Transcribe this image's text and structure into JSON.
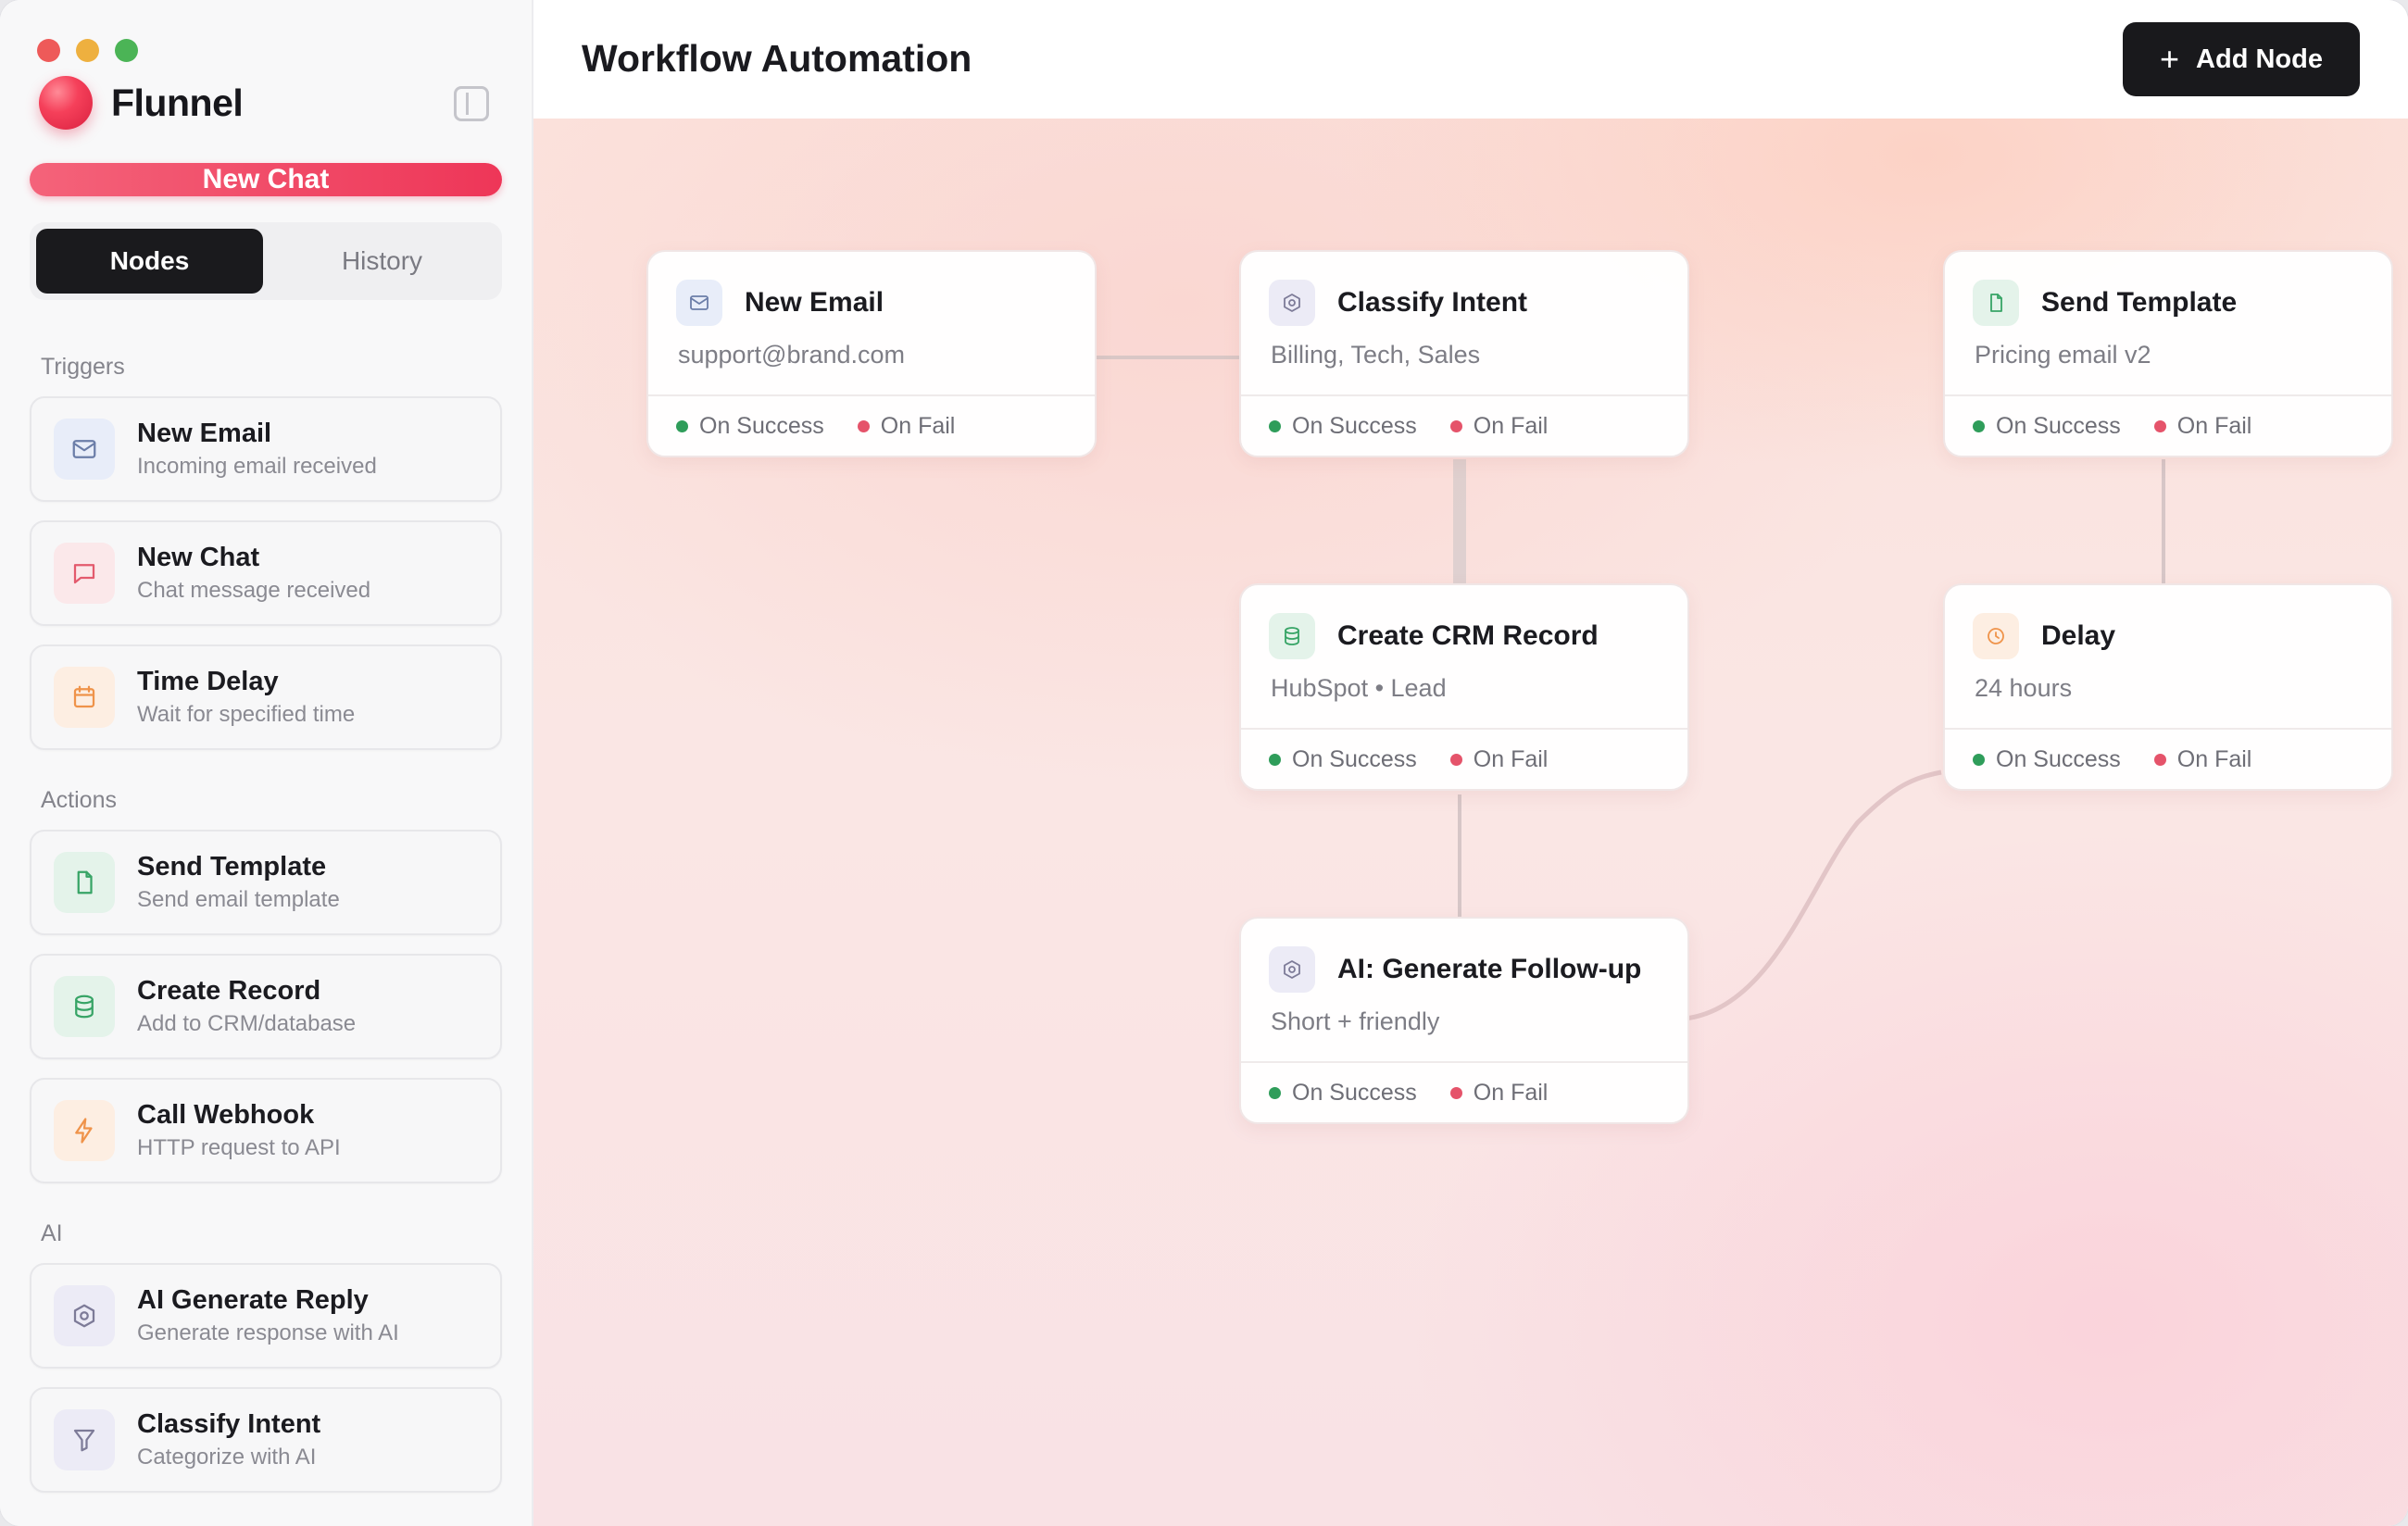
{
  "window": {
    "traffic_lights": [
      "close",
      "minimize",
      "maximize"
    ]
  },
  "app": {
    "name": "Flunnel"
  },
  "sidebar": {
    "new_chat_label": "New Chat",
    "tabs": [
      {
        "label": "Nodes",
        "active": true
      },
      {
        "label": "History",
        "active": false
      }
    ],
    "sections": {
      "triggers": {
        "label": "Triggers",
        "items": [
          {
            "title": "New Email",
            "subtitle": "Incoming email received",
            "icon": "mail-icon"
          },
          {
            "title": "New Chat",
            "subtitle": "Chat message received",
            "icon": "chat-icon"
          },
          {
            "title": "Time Delay",
            "subtitle": "Wait for specified time",
            "icon": "calendar-icon"
          }
        ]
      },
      "actions": {
        "label": "Actions",
        "items": [
          {
            "title": "Send Template",
            "subtitle": "Send email template",
            "icon": "file-icon"
          },
          {
            "title": "Create Record",
            "subtitle": "Add to CRM/database",
            "icon": "database-icon"
          },
          {
            "title": "Call Webhook",
            "subtitle": "HTTP request to API",
            "icon": "bolt-icon"
          }
        ]
      },
      "ai": {
        "label": "AI",
        "items": [
          {
            "title": "AI Generate Reply",
            "subtitle": "Generate response with AI",
            "icon": "ai-hexagon-icon"
          },
          {
            "title": "Classify Intent",
            "subtitle": "Categorize with AI",
            "icon": "filter-icon"
          }
        ]
      }
    }
  },
  "header": {
    "title": "Workflow Automation",
    "add_node_label": "Add Node"
  },
  "ports": {
    "success": "On Success",
    "fail": "On Fail"
  },
  "workflow": {
    "nodes": [
      {
        "id": "n1",
        "title": "New Email",
        "subtitle": "support@brand.com",
        "icon": "mail-icon"
      },
      {
        "id": "n2",
        "title": "Classify Intent",
        "subtitle": "Billing, Tech, Sales",
        "icon": "ai-hexagon-icon"
      },
      {
        "id": "n3",
        "title": "Send Template",
        "subtitle": "Pricing email v2",
        "icon": "file-icon"
      },
      {
        "id": "n4",
        "title": "Create CRM Record",
        "subtitle": "HubSpot • Lead",
        "icon": "database-icon"
      },
      {
        "id": "n5",
        "title": "Delay",
        "subtitle": "24 hours",
        "icon": "clock-icon"
      },
      {
        "id": "n6",
        "title": "AI: Generate Follow-up",
        "subtitle": "Short + friendly",
        "icon": "ai-hexagon-icon"
      }
    ],
    "edges": [
      [
        "n1",
        "n2"
      ],
      [
        "n2",
        "n4"
      ],
      [
        "n4",
        "n6"
      ],
      [
        "n3",
        "n5"
      ],
      [
        "n6",
        "n5"
      ]
    ]
  },
  "colors": {
    "accent": "#ee3658",
    "success": "#2f9d5a",
    "fail": "#e5536a",
    "dark_button": "#19191c"
  }
}
